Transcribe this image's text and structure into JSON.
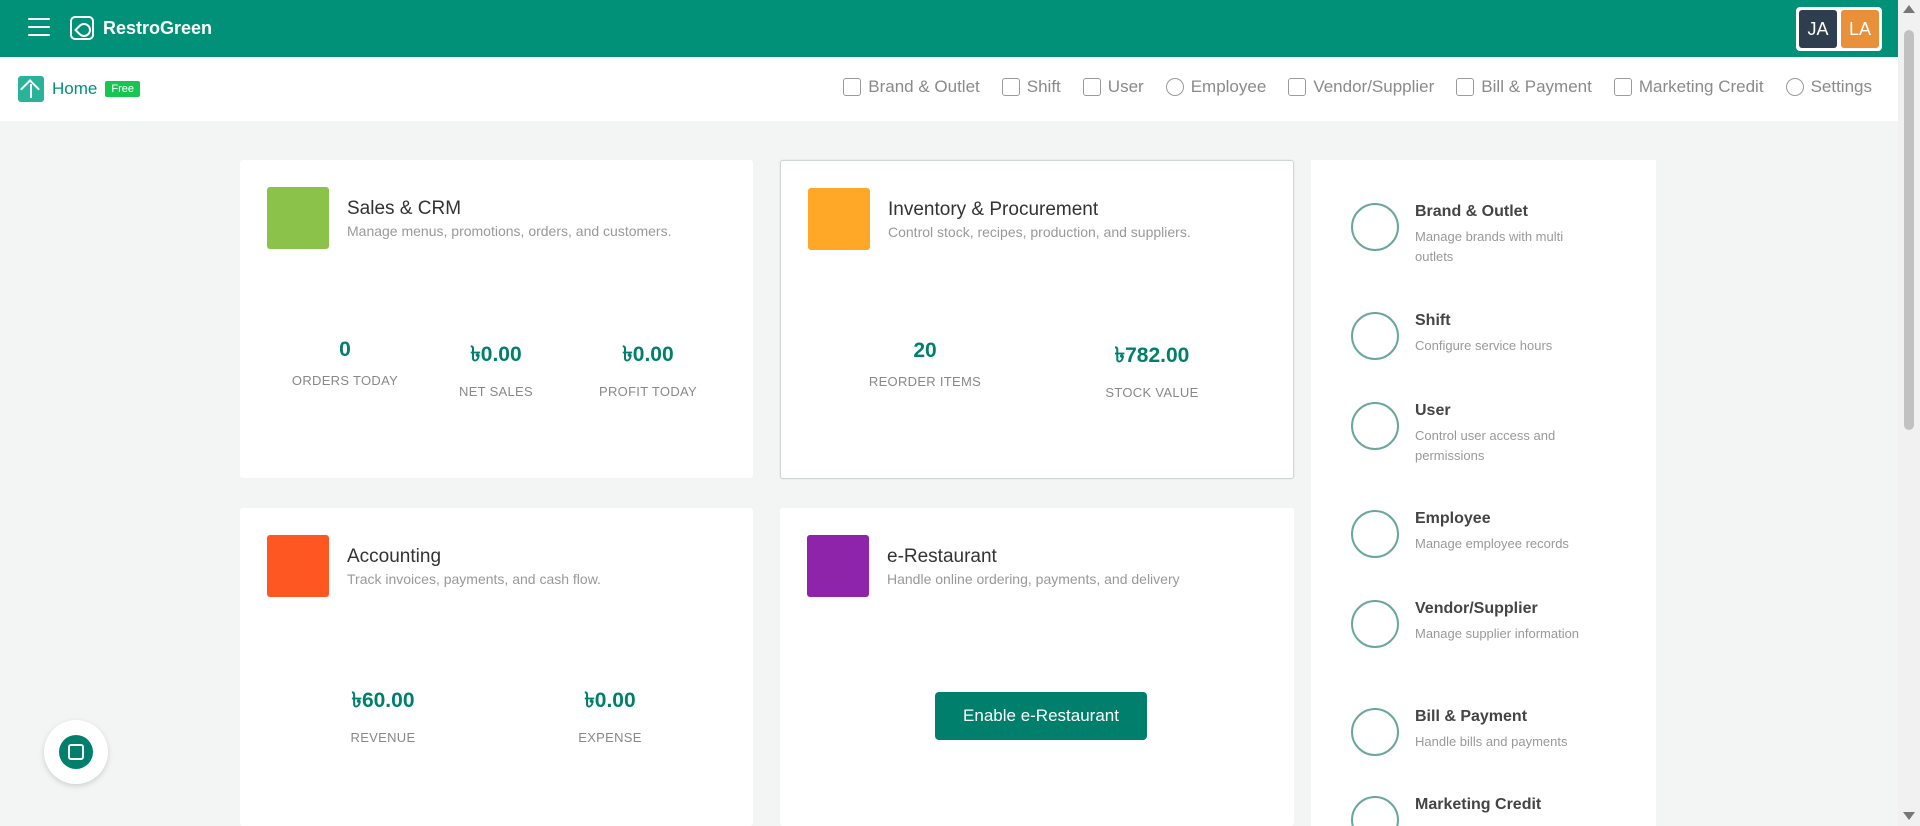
{
  "app": {
    "name": "RestroGreen"
  },
  "header": {
    "avatars": [
      {
        "initials": "JA",
        "color": "#2e3e4f"
      },
      {
        "initials": "LA",
        "color": "#e8913a"
      }
    ]
  },
  "subnav": {
    "home_label": "Home",
    "badge": "Free",
    "links": [
      {
        "label": "Brand & Outlet",
        "icon": "store-icon"
      },
      {
        "label": "Shift",
        "icon": "shift-icon"
      },
      {
        "label": "User",
        "icon": "user-lock-icon"
      },
      {
        "label": "Employee",
        "icon": "employee-icon"
      },
      {
        "label": "Vendor/Supplier",
        "icon": "vendor-icon"
      },
      {
        "label": "Bill & Payment",
        "icon": "bill-icon"
      },
      {
        "label": "Marketing Credit",
        "icon": "credit-icon"
      },
      {
        "label": "Settings",
        "icon": "settings-icon"
      }
    ]
  },
  "modules": {
    "sales": {
      "title": "Sales & CRM",
      "desc": "Manage menus, promotions, orders, and customers.",
      "icon_color": "#8bc34a",
      "stats": [
        {
          "value": "0",
          "label": "ORDERS TODAY"
        },
        {
          "value": "৳0.00",
          "label": "NET SALES"
        },
        {
          "value": "৳0.00",
          "label": "PROFIT TODAY"
        }
      ]
    },
    "inventory": {
      "title": "Inventory & Procurement",
      "desc": "Control stock, recipes, production, and suppliers.",
      "icon_color": "#ffa726",
      "stats": [
        {
          "value": "20",
          "label": "REORDER ITEMS"
        },
        {
          "value": "৳782.00",
          "label": "STOCK VALUE"
        }
      ]
    },
    "accounting": {
      "title": "Accounting",
      "desc": "Track invoices, payments, and cash flow.",
      "icon_color": "#ff5722",
      "stats": [
        {
          "value": "৳60.00",
          "label": "REVENUE"
        },
        {
          "value": "৳0.00",
          "label": "EXPENSE"
        }
      ]
    },
    "erestaurant": {
      "title": "e-Restaurant",
      "desc": "Handle online ordering, payments, and delivery",
      "icon_color": "#8e24aa",
      "button": "Enable e-Restaurant"
    }
  },
  "side": {
    "items": [
      {
        "title": "Brand & Outlet",
        "desc": "Manage brands with multi outlets",
        "icon": "star-icon"
      },
      {
        "title": "Shift",
        "desc": "Configure service hours",
        "icon": "shift-swap-icon"
      },
      {
        "title": "User",
        "desc": "Control user access and permissions",
        "icon": "user-list-icon"
      },
      {
        "title": "Employee",
        "desc": "Manage employee records",
        "icon": "employee-badge-icon"
      },
      {
        "title": "Vendor/Supplier",
        "desc": "Manage supplier information",
        "icon": "hand-truck-icon"
      },
      {
        "title": "Bill & Payment",
        "desc": "Handle bills and payments",
        "icon": "receipt-icon"
      },
      {
        "title": "Marketing Credit",
        "desc": "",
        "icon": "credit-card-icon"
      }
    ]
  }
}
